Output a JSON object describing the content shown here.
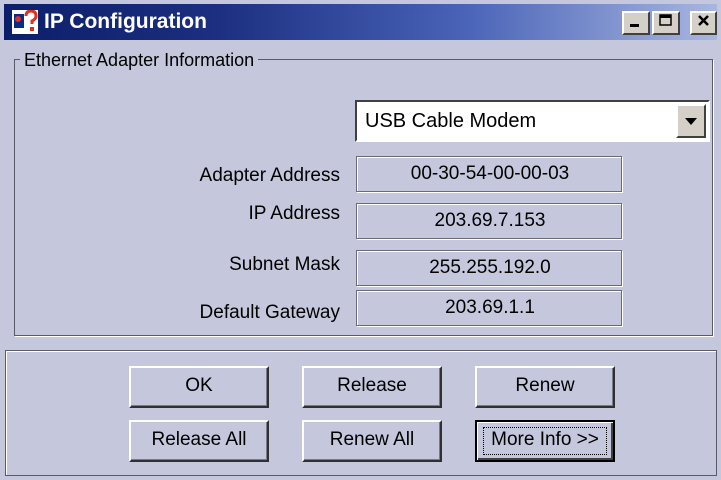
{
  "window": {
    "title": "IP Configuration",
    "icon": "network-help-icon",
    "caption_buttons": {
      "minimize": "_",
      "maximize": "□",
      "close": "x"
    }
  },
  "group": {
    "label": "Ethernet  Adapter Information"
  },
  "adapter_select": {
    "value": "USB Cable Modem"
  },
  "fields": {
    "adapter_address": {
      "label": "Adapter Address",
      "value": "00-30-54-00-00-03"
    },
    "ip_address": {
      "label": "IP Address",
      "value": "203.69.7.153"
    },
    "subnet_mask": {
      "label": "Subnet Mask",
      "value": "255.255.192.0"
    },
    "default_gateway": {
      "label": "Default Gateway",
      "value": "203.69.1.1"
    }
  },
  "buttons": {
    "ok": "OK",
    "release": "Release",
    "renew": "Renew",
    "release_all": "Release All",
    "renew_all": "Renew All",
    "more_info": "More Info >>"
  }
}
